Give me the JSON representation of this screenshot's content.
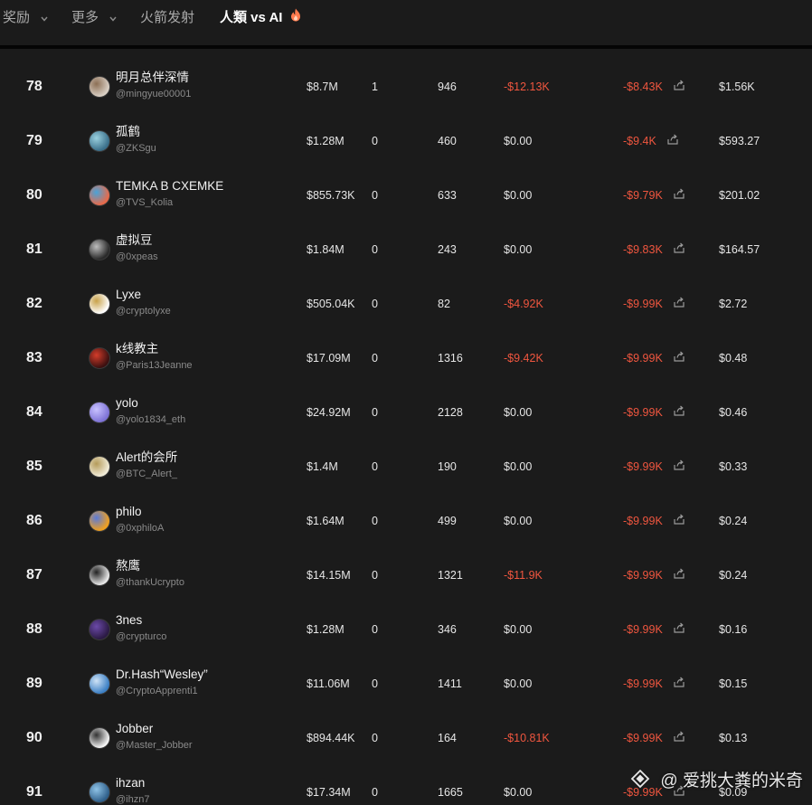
{
  "nav": {
    "items": [
      {
        "label": "奖励"
      },
      {
        "label": "更多"
      },
      {
        "label": "火箭发射"
      },
      {
        "label": "人類 vs AI"
      }
    ]
  },
  "colors": {
    "background": "#1b1b1b",
    "negative": "#f0563f",
    "text": "#e6e6e6",
    "muted": "#8a8a8a"
  },
  "rows": [
    {
      "rank": "78",
      "name": "明月总伴深情",
      "handle": "@mingyue00001",
      "volume": "$8.7M",
      "count": "1",
      "trades": "946",
      "pnl1": "-$12.13K",
      "pnl1_neg": true,
      "pnl2": "-$8.43K",
      "pnl2_neg": true,
      "last": "$1.56K"
    },
    {
      "rank": "79",
      "name": "孤鹤",
      "handle": "@ZKSgu",
      "volume": "$1.28M",
      "count": "0",
      "trades": "460",
      "pnl1": "$0.00",
      "pnl1_neg": false,
      "pnl2": "-$9.4K",
      "pnl2_neg": true,
      "last": "$593.27"
    },
    {
      "rank": "80",
      "name": "TEMKA B CXEMKE",
      "handle": "@TVS_Kolia",
      "volume": "$855.73K",
      "count": "0",
      "trades": "633",
      "pnl1": "$0.00",
      "pnl1_neg": false,
      "pnl2": "-$9.79K",
      "pnl2_neg": true,
      "last": "$201.02"
    },
    {
      "rank": "81",
      "name": "虚拟豆",
      "handle": "@0xpeas",
      "volume": "$1.84M",
      "count": "0",
      "trades": "243",
      "pnl1": "$0.00",
      "pnl1_neg": false,
      "pnl2": "-$9.83K",
      "pnl2_neg": true,
      "last": "$164.57"
    },
    {
      "rank": "82",
      "name": "Lyxe",
      "handle": "@cryptolyxe",
      "volume": "$505.04K",
      "count": "0",
      "trades": "82",
      "pnl1": "-$4.92K",
      "pnl1_neg": true,
      "pnl2": "-$9.99K",
      "pnl2_neg": true,
      "last": "$2.72"
    },
    {
      "rank": "83",
      "name": "k线教主",
      "handle": "@Paris13Jeanne",
      "volume": "$17.09M",
      "count": "0",
      "trades": "1316",
      "pnl1": "-$9.42K",
      "pnl1_neg": true,
      "pnl2": "-$9.99K",
      "pnl2_neg": true,
      "last": "$0.48"
    },
    {
      "rank": "84",
      "name": "yolo",
      "handle": "@yolo1834_eth",
      "volume": "$24.92M",
      "count": "0",
      "trades": "2128",
      "pnl1": "$0.00",
      "pnl1_neg": false,
      "pnl2": "-$9.99K",
      "pnl2_neg": true,
      "last": "$0.46"
    },
    {
      "rank": "85",
      "name": "Alert的会所",
      "handle": "@BTC_Alert_",
      "volume": "$1.4M",
      "count": "0",
      "trades": "190",
      "pnl1": "$0.00",
      "pnl1_neg": false,
      "pnl2": "-$9.99K",
      "pnl2_neg": true,
      "last": "$0.33"
    },
    {
      "rank": "86",
      "name": "philo",
      "handle": "@0xphiloA",
      "volume": "$1.64M",
      "count": "0",
      "trades": "499",
      "pnl1": "$0.00",
      "pnl1_neg": false,
      "pnl2": "-$9.99K",
      "pnl2_neg": true,
      "last": "$0.24"
    },
    {
      "rank": "87",
      "name": "熬鹰",
      "handle": "@thankUcrypto",
      "volume": "$14.15M",
      "count": "0",
      "trades": "1321",
      "pnl1": "-$11.9K",
      "pnl1_neg": true,
      "pnl2": "-$9.99K",
      "pnl2_neg": true,
      "last": "$0.24"
    },
    {
      "rank": "88",
      "name": "3nes",
      "handle": "@crypturco",
      "volume": "$1.28M",
      "count": "0",
      "trades": "346",
      "pnl1": "$0.00",
      "pnl1_neg": false,
      "pnl2": "-$9.99K",
      "pnl2_neg": true,
      "last": "$0.16"
    },
    {
      "rank": "89",
      "name": "Dr.Hash“Wesley”",
      "handle": "@CryptoApprenti1",
      "volume": "$11.06M",
      "count": "0",
      "trades": "1411",
      "pnl1": "$0.00",
      "pnl1_neg": false,
      "pnl2": "-$9.99K",
      "pnl2_neg": true,
      "last": "$0.15"
    },
    {
      "rank": "90",
      "name": "Jobber",
      "handle": "@Master_Jobber",
      "volume": "$894.44K",
      "count": "0",
      "trades": "164",
      "pnl1": "-$10.81K",
      "pnl1_neg": true,
      "pnl2": "-$9.99K",
      "pnl2_neg": true,
      "last": "$0.13"
    },
    {
      "rank": "91",
      "name": "ihzan",
      "handle": "@ihzn7",
      "volume": "$17.34M",
      "count": "0",
      "trades": "1665",
      "pnl1": "$0.00",
      "pnl1_neg": false,
      "pnl2": "-$9.99K",
      "pnl2_neg": true,
      "last": "$0.09"
    }
  ],
  "watermark": {
    "text": "@ 爱挑大粪的米奇"
  }
}
